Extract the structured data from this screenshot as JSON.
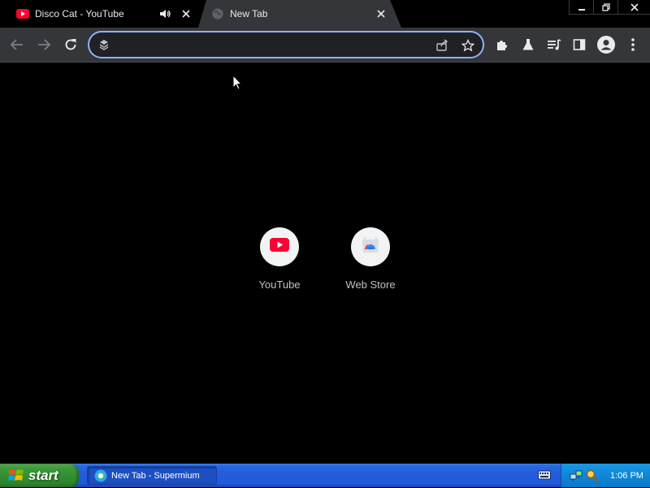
{
  "tabs": [
    {
      "title": "Disco Cat - YouTube",
      "favicon": "youtube-icon",
      "audio": "speaker-icon"
    },
    {
      "title": "New Tab",
      "favicon": "globe-icon"
    }
  ],
  "omnibox": {
    "value": "",
    "placeholder": ""
  },
  "shortcuts": [
    {
      "label": "YouTube",
      "icon": "youtube-icon"
    },
    {
      "label": "Web Store",
      "icon": "web-store-icon"
    }
  ],
  "taskbar": {
    "start_label": "start",
    "task_label": "New Tab - Supermium",
    "clock": "1:06 PM"
  },
  "colors": {
    "accent": "#8ab4f8",
    "youtube_red": "#ff0033",
    "toolbar": "#35363a",
    "taskbar_blue": "#245edb",
    "start_green": "#3c9a3a"
  }
}
